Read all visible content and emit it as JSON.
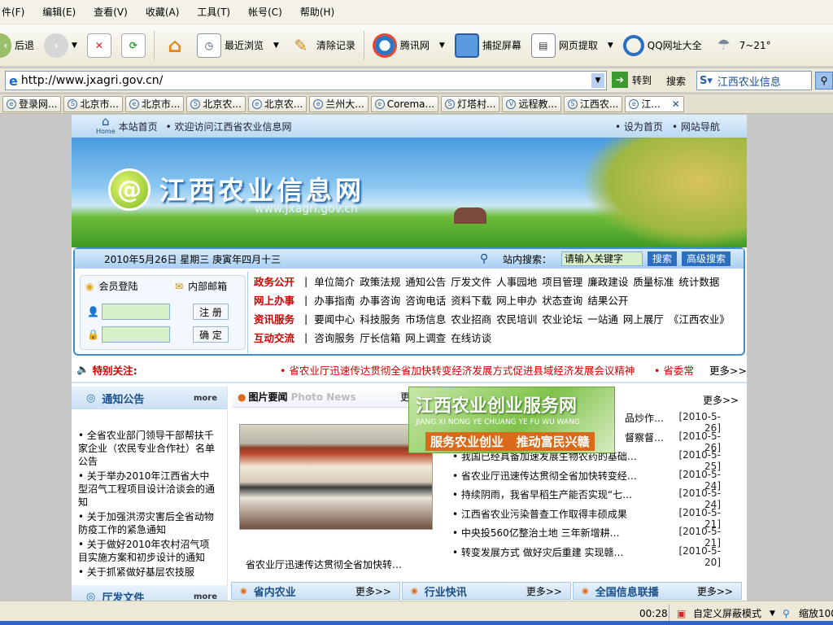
{
  "menubar": {
    "items": [
      "件(F)",
      "编辑(E)",
      "查看(V)",
      "收藏(A)",
      "工具(T)",
      "帐号(C)",
      "帮助(H)"
    ]
  },
  "toolbar": {
    "back": "后退",
    "recent": "最近浏览",
    "clear": "清除记录",
    "tencent": "腾讯网",
    "capture": "捕捉屏幕",
    "extract": "网页提取",
    "qq_nav": "QQ网址大全",
    "weather": "7~21°"
  },
  "address": {
    "url": "http://www.jxagri.gov.cn/",
    "go": "转到",
    "search_label": "搜索",
    "search_value": "江西农业信息"
  },
  "tabs": [
    {
      "icon": "e",
      "label": "登录网..."
    },
    {
      "icon": "S",
      "label": "北京市..."
    },
    {
      "icon": "e",
      "label": "北京市..."
    },
    {
      "icon": "S",
      "label": "北京农..."
    },
    {
      "icon": "e",
      "label": "北京农..."
    },
    {
      "icon": "e",
      "label": "兰州大..."
    },
    {
      "icon": "e",
      "label": "Corema..."
    },
    {
      "icon": "S",
      "label": "灯塔村..."
    },
    {
      "icon": "V",
      "label": "远程教..."
    },
    {
      "icon": "S",
      "label": "江西农..."
    },
    {
      "icon": "e",
      "label": "江..."
    }
  ],
  "site": {
    "top_home": "本站首页",
    "top_welcome": "• 欢迎访问江西省农业信息网",
    "top_right_1": "• 设为首页",
    "top_right_2": "• 网站导航",
    "home_caption": "Home",
    "logo_text": "江西农业信息网",
    "logo_url": "www.jxagri.gov.cn",
    "date": "2010年5月26日  星期三  庚寅年四月十三",
    "site_search_label": "站内搜索：",
    "site_search_value": "请输入关键字",
    "search_btn": "搜索",
    "adv_search_btn": "高级搜索",
    "login_tab": "会员登陆",
    "mail_tab": "内部邮箱",
    "register_btn": "注 册",
    "confirm_btn": "确 定",
    "nav": [
      {
        "head": "政务公开",
        "items": [
          "单位简介",
          "政策法规",
          "通知公告",
          "厅发文件",
          "人事园地",
          "项目管理",
          "廉政建设",
          "质量标准",
          "统计数据"
        ]
      },
      {
        "head": "网上办事",
        "items": [
          "办事指南",
          "办事咨询",
          "咨询电话",
          "资料下载",
          "网上申办",
          "状态查询",
          "结果公开"
        ]
      },
      {
        "head": "资讯服务",
        "items": [
          "要闻中心",
          "科技服务",
          "市场信息",
          "农业招商",
          "农民培训",
          "农业论坛",
          "一站通",
          "网上展厅",
          "《江西农业》"
        ]
      },
      {
        "head": "互动交流",
        "items": [
          "咨询服务",
          "厅长信箱",
          "网上调查",
          "在线访谈"
        ]
      }
    ],
    "special_label": "特别关注:",
    "special_text": "• 省农业厅迅速传达贯彻全省加快转变经济发展方式促进县域经济发展会议精神",
    "special_text2": "• 省委常",
    "special_more": "更多>>",
    "notice_head": "通知公告",
    "notice_more": "more",
    "notices": [
      "• 全省农业部门领导干部帮扶千家企业（农民专业合作社）名单公告",
      "• 关于举办2010年江西省大中型沼气工程项目设计洽谈会的通知",
      "• 关于加强洪涝灾害后全省动物防疫工作的紧急通知",
      "• 关于做好2010年农村沼气项目实施方案和初步设计的通知",
      "• 关于抓紧做好基层农技服"
    ],
    "docs_head": "厅发文件",
    "docs_more": "more",
    "photo_head": "图片要闻",
    "photo_head_en": "Photo News",
    "photo_head_more": "更",
    "photo_caption": "省农业厅迅速传达贯彻全省加快转…",
    "promo_title": "江西农业创业服务网",
    "promo_pinyin": "JIANG XI NONG YE CHUANG YE FU WU WANG",
    "promo_slogan": "服务农业创业   推动富民兴赣",
    "news_more": "更多>>",
    "news": [
      {
        "title": "品炒作…",
        "date": "[2010-5-26]"
      },
      {
        "title": "督察督…",
        "date": "[2010-5-26]"
      },
      {
        "title": "• 我国已经具备加速发展生物农药的基础…",
        "date": "[2010-5-25]"
      },
      {
        "title": "• 省农业厅迅速传达贯彻全省加快转变经…",
        "date": "[2010-5-24]"
      },
      {
        "title": "• 持续阴雨，我省早稻生产能否实现“七…",
        "date": "[2010-5-24]"
      },
      {
        "title": "• 江西省农业污染普查工作取得丰硕成果",
        "date": "[2010-5-21]"
      },
      {
        "title": "• 中央投560亿整治土地  三年新增耕…",
        "date": "[2010-5-21]"
      },
      {
        "title": "• 转变发展方式  做好灾后重建  实现赣…",
        "date": "[2010-5-20]"
      }
    ],
    "bottom_tabs": [
      {
        "label": "省内农业",
        "more": "更多>>"
      },
      {
        "label": "行业快讯",
        "more": "更多>>"
      },
      {
        "label": "全国信息联播",
        "more": "更多>>"
      }
    ]
  },
  "statusbar": {
    "time": "00:28",
    "mode": "自定义屏蔽模式",
    "zoom": "缩放100"
  },
  "colors": {
    "site_red": "#d00000",
    "site_blue": "#1b4f8a",
    "accent_green": "#55a71f"
  }
}
